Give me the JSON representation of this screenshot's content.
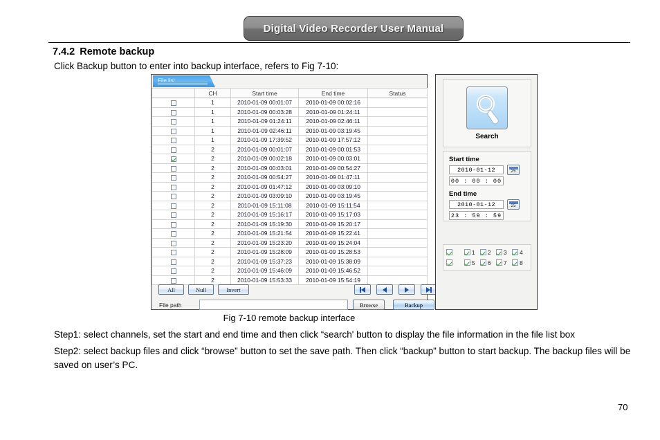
{
  "header": {
    "banner_title": "Digital Video Recorder User Manual"
  },
  "section": {
    "number": "7.4.2",
    "title": "Remote backup",
    "intro": "Click Backup button to enter into backup interface, refers to Fig 7-10:"
  },
  "figure": {
    "caption": "Fig 7-10 remote backup interface",
    "filelist": {
      "tab_label": "File list",
      "columns": [
        "",
        "CH",
        "Start time",
        "End time",
        "Status"
      ],
      "rows": [
        {
          "checked": false,
          "ch": "1",
          "start": "2010-01-09 00:01:07",
          "end": "2010-01-09 00:02:16",
          "status": ""
        },
        {
          "checked": false,
          "ch": "1",
          "start": "2010-01-09 00:03:28",
          "end": "2010-01-09 01:24:11",
          "status": ""
        },
        {
          "checked": false,
          "ch": "1",
          "start": "2010-01-09 01:24:11",
          "end": "2010-01-09 02:46:11",
          "status": ""
        },
        {
          "checked": false,
          "ch": "1",
          "start": "2010-01-09 02:46:11",
          "end": "2010-01-09 03:19:45",
          "status": ""
        },
        {
          "checked": false,
          "ch": "1",
          "start": "2010-01-09 17:39:52",
          "end": "2010-01-09 17:57:12",
          "status": ""
        },
        {
          "checked": false,
          "ch": "2",
          "start": "2010-01-09 00:01:07",
          "end": "2010-01-09 00:01:53",
          "status": ""
        },
        {
          "checked": true,
          "ch": "2",
          "start": "2010-01-09 00:02:18",
          "end": "2010-01-09 00:03:01",
          "status": ""
        },
        {
          "checked": false,
          "ch": "2",
          "start": "2010-01-09 00:03:01",
          "end": "2010-01-09 00:54:27",
          "status": ""
        },
        {
          "checked": false,
          "ch": "2",
          "start": "2010-01-09 00:54:27",
          "end": "2010-01-09 01:47:11",
          "status": ""
        },
        {
          "checked": false,
          "ch": "2",
          "start": "2010-01-09 01:47:12",
          "end": "2010-01-09 03:09:10",
          "status": ""
        },
        {
          "checked": false,
          "ch": "2",
          "start": "2010-01-09 03:09:10",
          "end": "2010-01-09 03:19:45",
          "status": ""
        },
        {
          "checked": false,
          "ch": "2",
          "start": "2010-01-09 15:11:08",
          "end": "2010-01-09 15:11:54",
          "status": ""
        },
        {
          "checked": false,
          "ch": "2",
          "start": "2010-01-09 15:16:17",
          "end": "2010-01-09 15:17:03",
          "status": ""
        },
        {
          "checked": false,
          "ch": "2",
          "start": "2010-01-09 15:19:30",
          "end": "2010-01-09 15:20:17",
          "status": ""
        },
        {
          "checked": false,
          "ch": "2",
          "start": "2010-01-09 15:21:54",
          "end": "2010-01-09 15:22:41",
          "status": ""
        },
        {
          "checked": false,
          "ch": "2",
          "start": "2010-01-09 15:23:20",
          "end": "2010-01-09 15:24:04",
          "status": ""
        },
        {
          "checked": false,
          "ch": "2",
          "start": "2010-01-09 15:28:09",
          "end": "2010-01-09 15:28:53",
          "status": ""
        },
        {
          "checked": false,
          "ch": "2",
          "start": "2010-01-09 15:37:23",
          "end": "2010-01-09 15:38:09",
          "status": ""
        },
        {
          "checked": false,
          "ch": "2",
          "start": "2010-01-09 15:46:09",
          "end": "2010-01-09 15:46:52",
          "status": ""
        },
        {
          "checked": false,
          "ch": "2",
          "start": "2010-01-09 15:53:33",
          "end": "2010-01-09 15:54:19",
          "status": ""
        }
      ]
    },
    "controls": {
      "all_label": "All",
      "null_label": "Null",
      "invert_label": "Invert",
      "nav": {
        "first": "first-page",
        "prev": "previous-page",
        "next": "next-page",
        "last": "last-page"
      },
      "file_path_label": "File path",
      "file_path_value": "",
      "file_path_placeholder": "",
      "browse_label": "Browse",
      "backup_label": "Backup"
    },
    "right_panel": {
      "search_icon": "magnifier-icon",
      "search_label": "Search",
      "start_time": {
        "title": "Start time",
        "date": "2010-01-12",
        "time": "00 : 00 : 00",
        "calendar_icon": "calendar-icon",
        "calendar_day": "25"
      },
      "end_time": {
        "title": "End time",
        "date": "2010-01-12",
        "time": "23 : 59 : 59",
        "calendar_icon": "calendar-icon",
        "calendar_day": "25"
      },
      "channels": {
        "row1": [
          "",
          "1",
          "2",
          "3",
          "4"
        ],
        "row2": [
          "",
          "5",
          "6",
          "7",
          "8"
        ]
      }
    }
  },
  "steps": {
    "step1": "Step1: select channels, set the start and end time and then click “search' button to display the file information in the file list box",
    "step2": "Step2: select backup files and click “browse” button to set the save path. Then click “backup” button to start backup. The backup files will be saved on user’s PC."
  },
  "footer": {
    "page_number": "70"
  },
  "colors": {
    "banner": "#7d7d7d",
    "tab_blue": "#4ea3e8",
    "check_green": "#2a9c3a",
    "accent_blue": "#1b4f9c"
  }
}
